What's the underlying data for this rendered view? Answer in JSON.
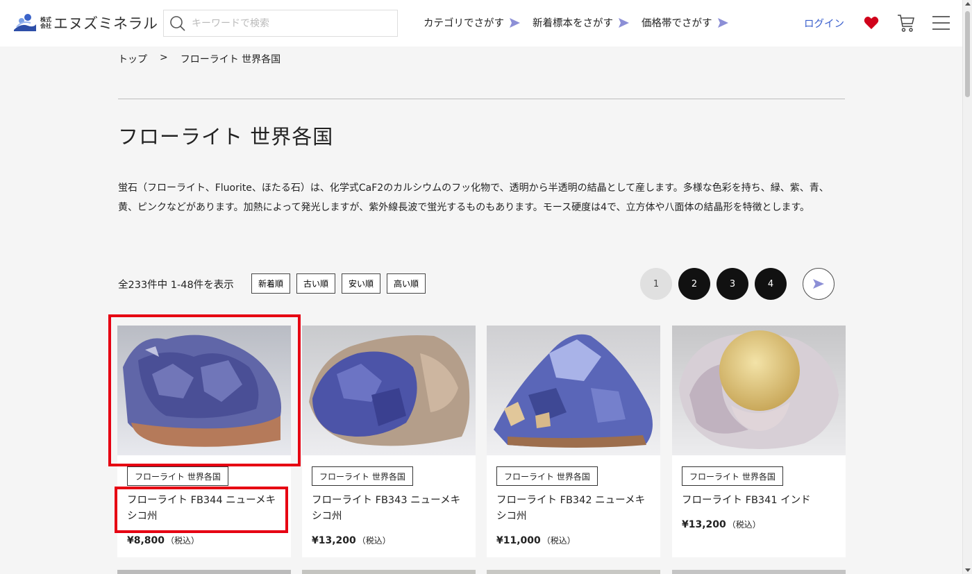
{
  "header": {
    "logo_prefix": "株式会社",
    "logo_prefix_top": "株式",
    "logo_prefix_bottom": "会社",
    "logo_name": "エヌズミネラル",
    "search_placeholder": "キーワードで検索",
    "nav": [
      {
        "label": "カテゴリでさがす"
      },
      {
        "label": "新着標本をさがす"
      },
      {
        "label": "価格帯でさがす"
      }
    ],
    "login_label": "ログイン"
  },
  "colors": {
    "accent_blue": "#3a5fcd",
    "nav_arrow": "#8c8fd6",
    "heart_red": "#d0021b",
    "highlight_red": "#e60012"
  },
  "breadcrumb": {
    "home": "トップ",
    "separator": ">",
    "current": "フローライト 世界各国"
  },
  "page": {
    "title": "フローライト 世界各国",
    "description": "蛍石（フローライト、Fluorite、ほたる石）は、化学式CaF2のカルシウムのフッ化物で、透明から半透明の結晶として産します。多様な色彩を持ち、緑、紫、青、黄、ピンクなどがあります。加熱によって発光しますが、紫外線長波で蛍光するものもあります。モース硬度は4で、立方体や八面体の結晶形を特徴とします。"
  },
  "listing": {
    "count_text": "全233件中 1-48件を表示",
    "sort_options": [
      "新着順",
      "古い順",
      "安い順",
      "高い順"
    ],
    "pages": [
      "1",
      "2",
      "3",
      "4"
    ],
    "current_page": "1"
  },
  "products": [
    {
      "tag": "フローライト 世界各国",
      "name": "フローライト FB344 ニューメキシコ州",
      "price": "¥8,800",
      "tax": "（税込）"
    },
    {
      "tag": "フローライト 世界各国",
      "name": "フローライト FB343 ニューメキシコ州",
      "price": "¥13,200",
      "tax": "（税込）"
    },
    {
      "tag": "フローライト 世界各国",
      "name": "フローライト FB342 ニューメキシコ州",
      "price": "¥11,000",
      "tax": "（税込）"
    },
    {
      "tag": "フローライト 世界各国",
      "name": "フローライト FB341 インド",
      "price": "¥13,200",
      "tax": "（税込）"
    }
  ]
}
